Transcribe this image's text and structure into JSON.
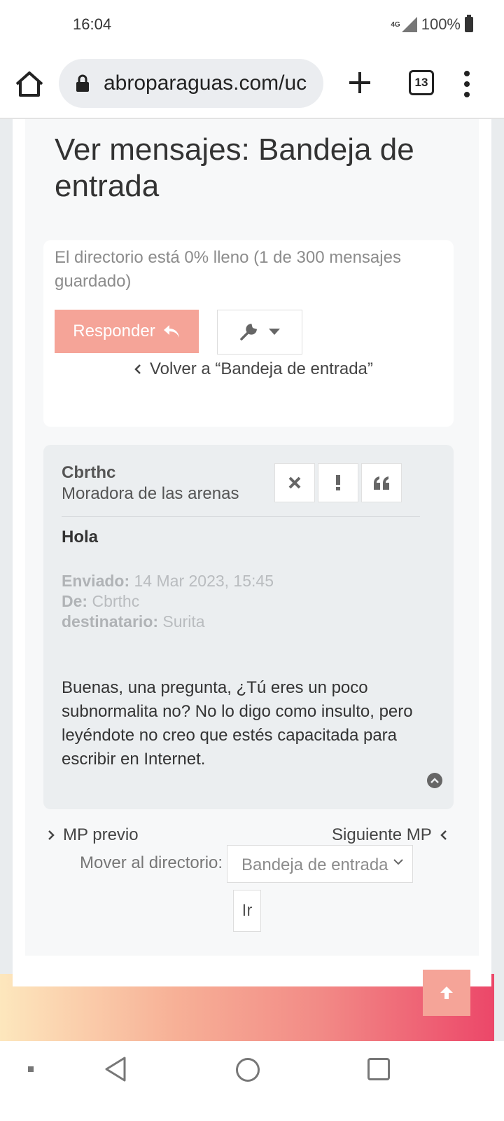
{
  "status_bar": {
    "time": "16:04",
    "network": "4G",
    "battery": "100%"
  },
  "browser": {
    "url": "abroparaguas.com/uc",
    "tab_count": "13"
  },
  "page": {
    "title": "Ver mensajes: Bandeja de entrada",
    "storage_text": "El directorio está 0% lleno (1 de 300 mensajes guardado)",
    "reply_label": "Responder",
    "back_link": "Volver a “Bandeja de entrada”"
  },
  "message": {
    "author": "Cbrthc",
    "rank": "Moradora de las arenas",
    "subject": "Hola",
    "sent_label": "Enviado:",
    "sent_value": "14 Mar 2023, 15:45",
    "from_label": "De:",
    "from_value": "Cbrthc",
    "to_label": "destinatario:",
    "to_value": "Surita",
    "body": "Buenas, una pregunta, ¿Tú eres un poco subnormalita no? No lo digo como insulto, pero leyéndote no creo que estés capacitada para escribir en Internet."
  },
  "navigation": {
    "prev_label": "MP previo",
    "next_label": "Siguiente MP",
    "move_label": "Mover al directorio:",
    "folder_selected": "Bandeja de entrada",
    "go_label": "Ir"
  },
  "colors": {
    "accent": "#f5a498",
    "card_bg": "#ebeef0"
  }
}
